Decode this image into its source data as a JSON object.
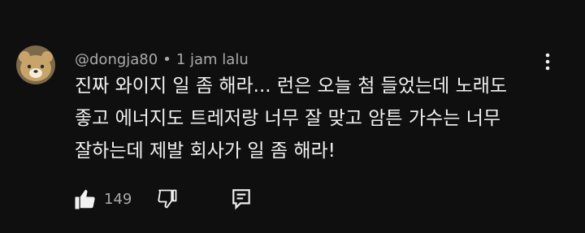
{
  "comment": {
    "author": "@dongja80",
    "separator": "•",
    "timestamp": "1 jam lalu",
    "text": "진짜 와이지 일 좀 해라... 런은 오늘 첨 들었는데 노래도\n좋고 에너지도 트레저랑 너무 잘 맞고 암튼 가수는 너무\n잘하는데 제발 회사가 일 좀 해라!",
    "like_count": "149",
    "avatar_icon": "bear-face-avatar",
    "icons": {
      "like": "thumbs-up-icon",
      "dislike": "thumbs-down-icon",
      "reply": "reply-comment-icon",
      "menu": "more-vertical-icon"
    }
  },
  "colors": {
    "background": "#0f0f0f",
    "text_primary": "#f1f1f1",
    "text_secondary": "#aaaaaa",
    "avatar_fur": "#c8a46a"
  }
}
